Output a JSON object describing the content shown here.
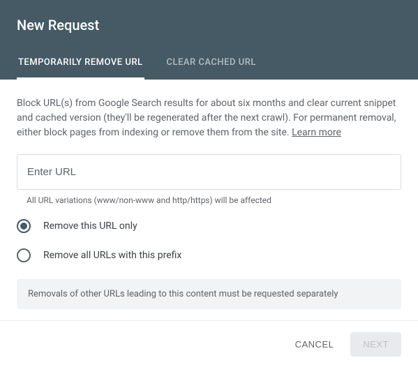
{
  "header": {
    "title": "New Request"
  },
  "tabs": {
    "temp": "TEMPORARILY REMOVE URL",
    "cached": "CLEAR CACHED URL"
  },
  "description": "Block URL(s) from Google Search results for about six months and clear current snippet and cached version (they'll be regenerated after the next crawl). For permanent removal, either block pages from indexing or remove them from the site. ",
  "learn_more": "Learn more",
  "input": {
    "placeholder": "Enter URL",
    "helper": "All URL variations (www/non-www and http/https) will be affected"
  },
  "radio": {
    "only": "Remove this URL only",
    "prefix": "Remove all URLs with this prefix"
  },
  "info": "Removals of other URLs leading to this content must be requested separately",
  "footer": {
    "cancel": "CANCEL",
    "next": "NEXT"
  }
}
